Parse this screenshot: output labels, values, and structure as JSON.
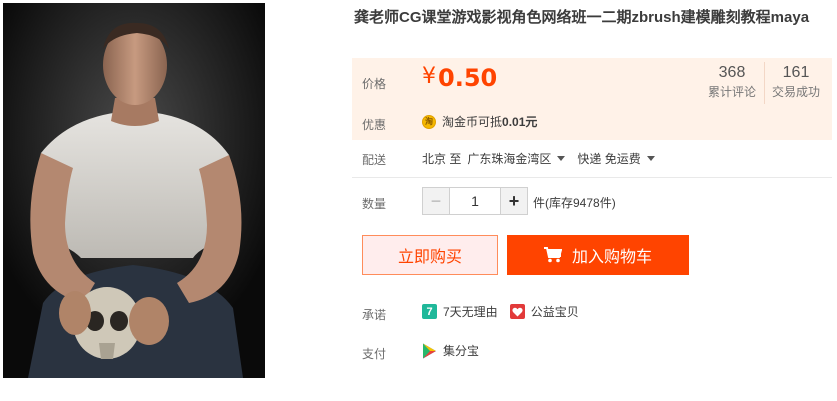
{
  "product": {
    "title": "龚老师CG课堂游戏影视角色网络班一二期zbrush建模雕刻教程maya",
    "image_icon": "product-photo-man-with-skull"
  },
  "price": {
    "label": "价格",
    "currency": "¥",
    "amount": "0.50",
    "color": "#ff4400"
  },
  "stats": [
    {
      "value": "368",
      "label": "累计评论"
    },
    {
      "value": "161",
      "label": "交易成功"
    }
  ],
  "promotion": {
    "label": "优惠",
    "icon": "taojinbi-coin-icon",
    "icon_text": "淘",
    "text_prefix": "淘金币可抵",
    "text_amount": "0.01元"
  },
  "delivery": {
    "label": "配送",
    "from": "北京 至",
    "to": "广东珠海金湾区",
    "method": "快递 免运费"
  },
  "quantity": {
    "label": "数量",
    "value": "1",
    "minus": "−",
    "plus": "+",
    "stock": "件(库存9478件)"
  },
  "actions": {
    "buy_now": "立即购买",
    "add_to_cart": "加入购物车",
    "accent": "#ff4400"
  },
  "promise": {
    "label": "承诺",
    "items": [
      {
        "icon": "seven-day-return-icon",
        "icon_text": "7",
        "text": "7天无理由"
      },
      {
        "icon": "charity-heart-icon",
        "text": "公益宝贝"
      }
    ]
  },
  "payment": {
    "label": "支付",
    "icon": "jifenbao-play-icon",
    "text": "集分宝"
  }
}
